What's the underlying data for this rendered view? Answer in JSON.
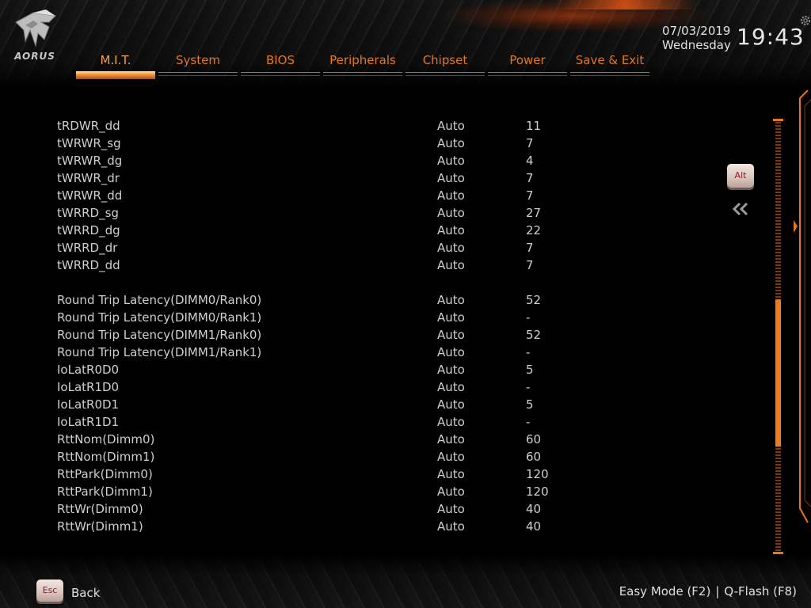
{
  "brand": {
    "logo_text": "AORUS",
    "accent": "#e8761c",
    "active_tab_color": "#f19136"
  },
  "header": {
    "tabs": [
      {
        "label": "M.I.T.",
        "active": true
      },
      {
        "label": "System",
        "active": false
      },
      {
        "label": "BIOS",
        "active": false
      },
      {
        "label": "Peripherals",
        "active": false
      },
      {
        "label": "Chipset",
        "active": false
      },
      {
        "label": "Power",
        "active": false
      },
      {
        "label": "Save & Exit",
        "active": false
      }
    ],
    "date": "07/03/2019",
    "day": "Wednesday",
    "time": "19:43",
    "settings_icon": "gear-icon"
  },
  "settings": {
    "rows": [
      {
        "name": "tRDWR_dd",
        "mode": "Auto",
        "value": "11"
      },
      {
        "name": "tWRWR_sg",
        "mode": "Auto",
        "value": "7"
      },
      {
        "name": "tWRWR_dg",
        "mode": "Auto",
        "value": "4"
      },
      {
        "name": "tWRWR_dr",
        "mode": "Auto",
        "value": "7"
      },
      {
        "name": "tWRWR_dd",
        "mode": "Auto",
        "value": "7"
      },
      {
        "name": "tWRRD_sg",
        "mode": "Auto",
        "value": "27"
      },
      {
        "name": "tWRRD_dg",
        "mode": "Auto",
        "value": "22"
      },
      {
        "name": "tWRRD_dr",
        "mode": "Auto",
        "value": "7"
      },
      {
        "name": "tWRRD_dd",
        "mode": "Auto",
        "value": "7"
      },
      {
        "spacer": true
      },
      {
        "name": "Round Trip Latency(DIMM0/Rank0)",
        "mode": "Auto",
        "value": "52"
      },
      {
        "name": "Round Trip Latency(DIMM0/Rank1)",
        "mode": "Auto",
        "value": "-"
      },
      {
        "name": "Round Trip Latency(DIMM1/Rank0)",
        "mode": "Auto",
        "value": "52"
      },
      {
        "name": "Round Trip Latency(DIMM1/Rank1)",
        "mode": "Auto",
        "value": "-"
      },
      {
        "name": "IoLatR0D0",
        "mode": "Auto",
        "value": "5"
      },
      {
        "name": "IoLatR1D0",
        "mode": "Auto",
        "value": "-"
      },
      {
        "name": "IoLatR0D1",
        "mode": "Auto",
        "value": "5"
      },
      {
        "name": "IoLatR1D1",
        "mode": "Auto",
        "value": "-"
      },
      {
        "name": "RttNom(Dimm0)",
        "mode": "Auto",
        "value": "60"
      },
      {
        "name": "RttNom(Dimm1)",
        "mode": "Auto",
        "value": "60"
      },
      {
        "name": "RttPark(Dimm0)",
        "mode": "Auto",
        "value": "120"
      },
      {
        "name": "RttPark(Dimm1)",
        "mode": "Auto",
        "value": "120"
      },
      {
        "name": "RttWr(Dimm0)",
        "mode": "Auto",
        "value": "40"
      },
      {
        "name": "RttWr(Dimm1)",
        "mode": "Auto",
        "value": "40"
      }
    ]
  },
  "side": {
    "alt_key": "Alt",
    "collapse_icon": "double-chevron-left-icon",
    "scroll_position": 0.63
  },
  "footer": {
    "esc_key": "Esc",
    "back_label": "Back",
    "easy_mode": "Easy Mode (F2)",
    "separator": "|",
    "qflash": "Q-Flash (F8)"
  }
}
